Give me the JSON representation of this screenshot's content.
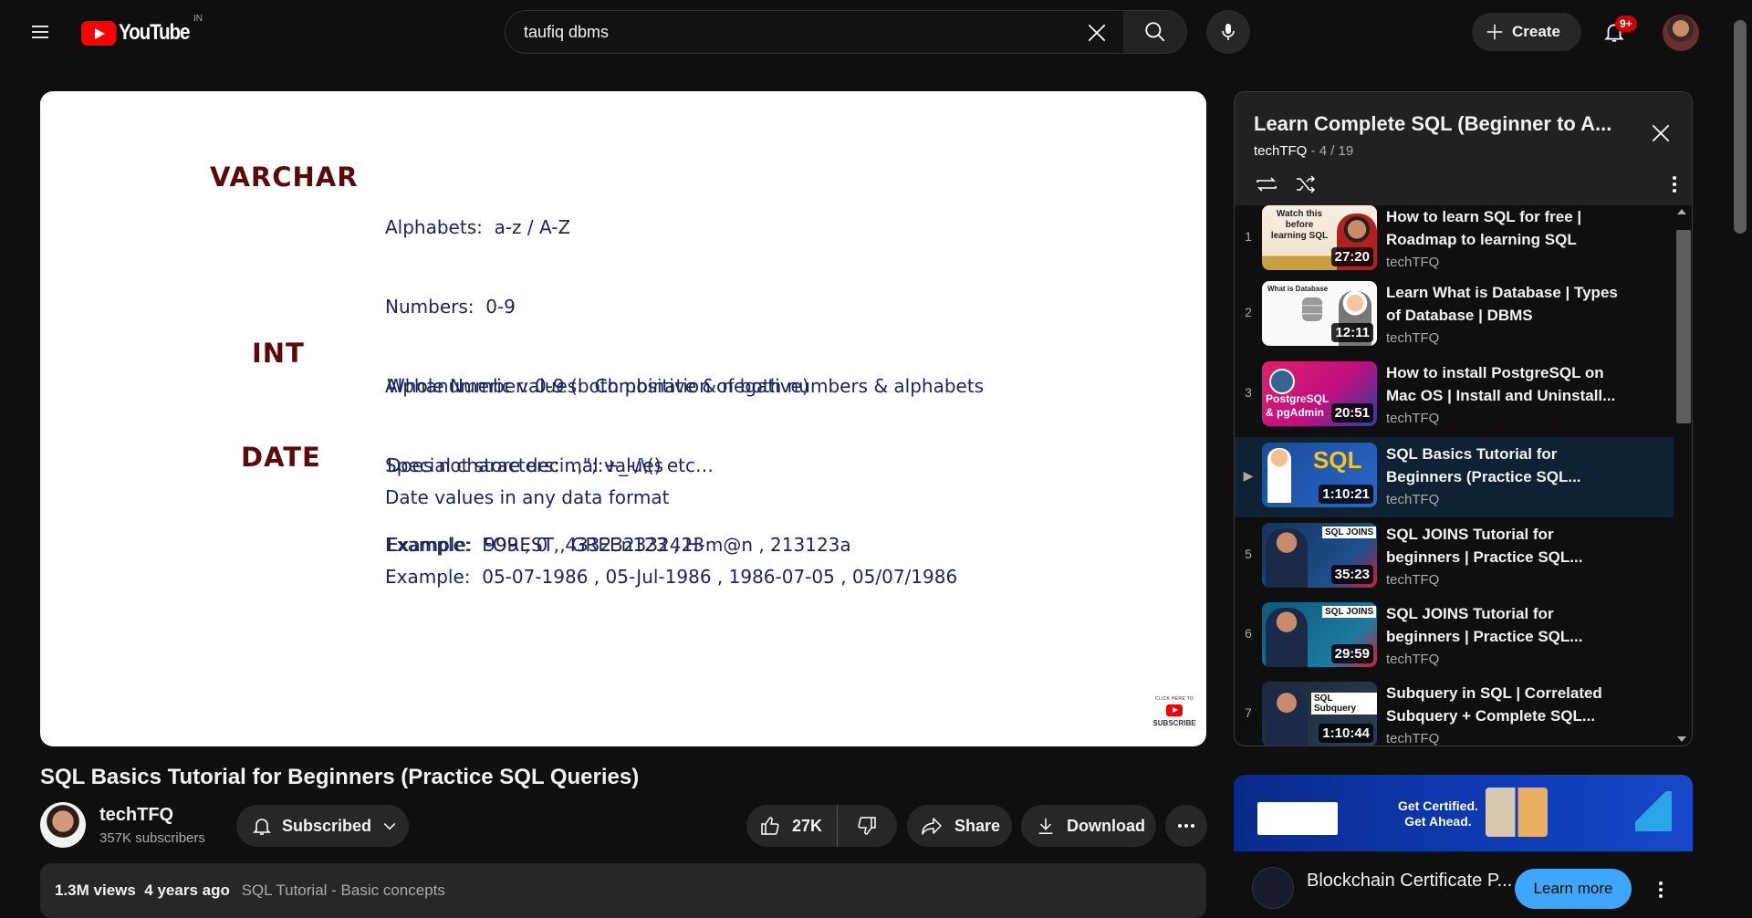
{
  "header": {
    "logo_text": "YouTube",
    "country_code": "IN",
    "search_value": "taufiq dbms",
    "create_label": "Create",
    "notification_count": "9+"
  },
  "player": {
    "slide": {
      "varchar_label": "VARCHAR",
      "varchar_lines": [
        "Alphabets:  a-z / A-Z",
        "Numbers:  0-9",
        "Alphanumeric values:  Combination of both numbers & alphabets",
        "Special characters:  .,\";:+_-/\\() etc…",
        "Example:  FOREST , GREEn123 , H-m@n , 213123a"
      ],
      "int_label": "INT",
      "int_lines": [
        "Whole Number: 0-9 (both positive & negative)",
        "Does not store decimal values",
        "Example:  999 , 0 , 433232332423"
      ],
      "date_label": "DATE",
      "date_lines": [
        "Date values in any data format",
        "Example:  05-07-1986 , 05-Jul-1986 , 1986-07-05 , 05/07/1986"
      ],
      "subscribe_top": "CLICK HERE TO",
      "subscribe_bottom": "SUBSCRIBE"
    }
  },
  "video": {
    "title": "SQL Basics Tutorial for Beginners (Practice SQL Queries)",
    "channel_name": "techTFQ",
    "subscribers": "357K subscribers",
    "subscribed_label": "Subscribed",
    "likes": "27K",
    "share_label": "Share",
    "download_label": "Download",
    "views": "1.3M views",
    "age": "4 years ago",
    "tag": "SQL Tutorial - Basic concepts"
  },
  "playlist": {
    "title": "Learn Complete SQL (Beginner to A...",
    "channel": "techTFQ",
    "position": "- 4 / 19",
    "items": [
      {
        "index": "1",
        "title": "How to learn SQL for free | Roadmap to learning SQL",
        "channel": "techTFQ",
        "duration": "27:20",
        "thumb_text": "Watch this before learning SQL"
      },
      {
        "index": "2",
        "title": "Learn What is Database | Types of Database | DBMS",
        "channel": "techTFQ",
        "duration": "12:11",
        "thumb_text": "What is Database"
      },
      {
        "index": "3",
        "title": "How to install PostgreSQL on Mac OS | Install and Uninstall...",
        "channel": "techTFQ",
        "duration": "20:51",
        "thumb_text": "PostgreSQL & pgAdmin"
      },
      {
        "index": "▶",
        "title": "SQL Basics Tutorial for Beginners (Practice SQL...",
        "channel": "techTFQ",
        "duration": "1:10:21",
        "thumb_text": "SQL"
      },
      {
        "index": "5",
        "title": "SQL JOINS Tutorial for beginners | Practice SQL...",
        "channel": "techTFQ",
        "duration": "35:23",
        "thumb_text": "SQL JOINS"
      },
      {
        "index": "6",
        "title": "SQL JOINS Tutorial for beginners | Practice SQL...",
        "channel": "techTFQ",
        "duration": "29:59",
        "thumb_text": "SQL JOINS"
      },
      {
        "index": "7",
        "title": "Subquery in SQL | Correlated Subquery + Complete SQL...",
        "channel": "techTFQ",
        "duration": "1:10:44",
        "thumb_text": "SQL Subquery"
      }
    ]
  },
  "ad": {
    "banner_text_1": "Get Certified.",
    "banner_text_2": "Get Ahead.",
    "title": "Blockchain Certificate P...",
    "cta": "Learn more"
  },
  "colors": {
    "background": "#0f0f0f",
    "accent_blue": "#3ea6ff",
    "youtube_red": "#ff0000",
    "active_row": "#0e2233"
  }
}
